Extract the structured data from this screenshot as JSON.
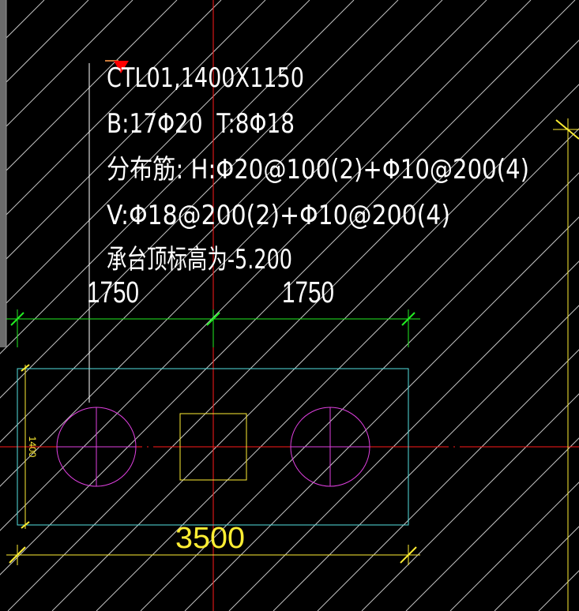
{
  "drawing": {
    "background": "#000000",
    "colors": {
      "hatch": "#e6e6e6",
      "axis_red": "#ff1a1a",
      "dim_green": "#22ee22",
      "outline_cyan": "#55e0e0",
      "pile_magenta": "#e040e0",
      "column_yellow": "#ffee33",
      "text_white": "#ffffff",
      "marker_red": "#ff0000"
    },
    "annotation": {
      "line1": "CTL01,1400X1150",
      "line2": "B:17Φ20  T:8Φ18",
      "line3": "分布筋: H:Φ20@100(2)+Φ10@200(4)",
      "line4": "V:Φ18@200(2)+Φ10@200(4)",
      "line5": "承台顶标高为-5.200"
    },
    "dimensions": {
      "top_left": "1750",
      "top_right": "1750",
      "bottom": "3500",
      "left_side": "1400"
    }
  }
}
